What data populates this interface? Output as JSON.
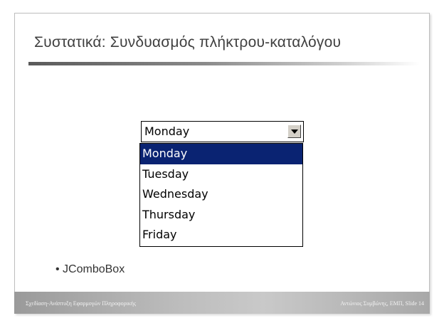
{
  "slide": {
    "title": "Συστατικά: Συνδυασμός πλήκτρου-καταλόγου",
    "bullet": "• JComboBox",
    "footer_left": "Σχεδίαση-Ανάπτυξη Εφαρμογών Πληροφορικής",
    "footer_right": "Αντώνιος Συμβώνης, ΕΜΠ, Slide 14"
  },
  "combo": {
    "selected_value": "Monday",
    "options": [
      "Monday",
      "Tuesday",
      "Wednesday",
      "Thursday",
      "Friday"
    ],
    "highlighted_index": 0,
    "highlight_color": "#0a2372"
  },
  "icons": {
    "dropdown_button": "chevron-down-icon"
  }
}
